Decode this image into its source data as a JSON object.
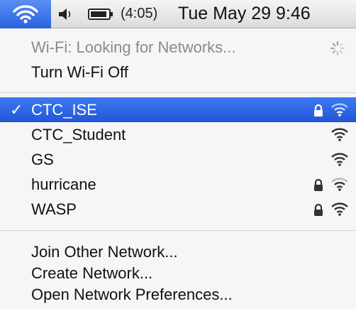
{
  "menubar": {
    "wifi_icon": "wifi-icon",
    "sound_icon": "speaker-icon",
    "battery_icon": "battery-icon",
    "battery_text": "(4:05)",
    "clock": "Tue May 29  9:46"
  },
  "menu": {
    "status": "Wi-Fi: Looking for Networks...",
    "turn_off": "Turn Wi-Fi Off",
    "networks": [
      {
        "name": "CTC_ISE",
        "selected": true,
        "locked": true
      },
      {
        "name": "CTC_Student",
        "selected": false,
        "locked": false
      },
      {
        "name": "GS",
        "selected": false,
        "locked": false
      },
      {
        "name": "hurricane",
        "selected": false,
        "locked": true
      },
      {
        "name": "WASP",
        "selected": false,
        "locked": true
      }
    ],
    "checkmark": "✓",
    "join_other": "Join Other Network...",
    "create": "Create Network...",
    "preferences": "Open Network Preferences..."
  },
  "colors": {
    "selection": "#2f67e6",
    "menubar_active": "#3b74ea"
  }
}
